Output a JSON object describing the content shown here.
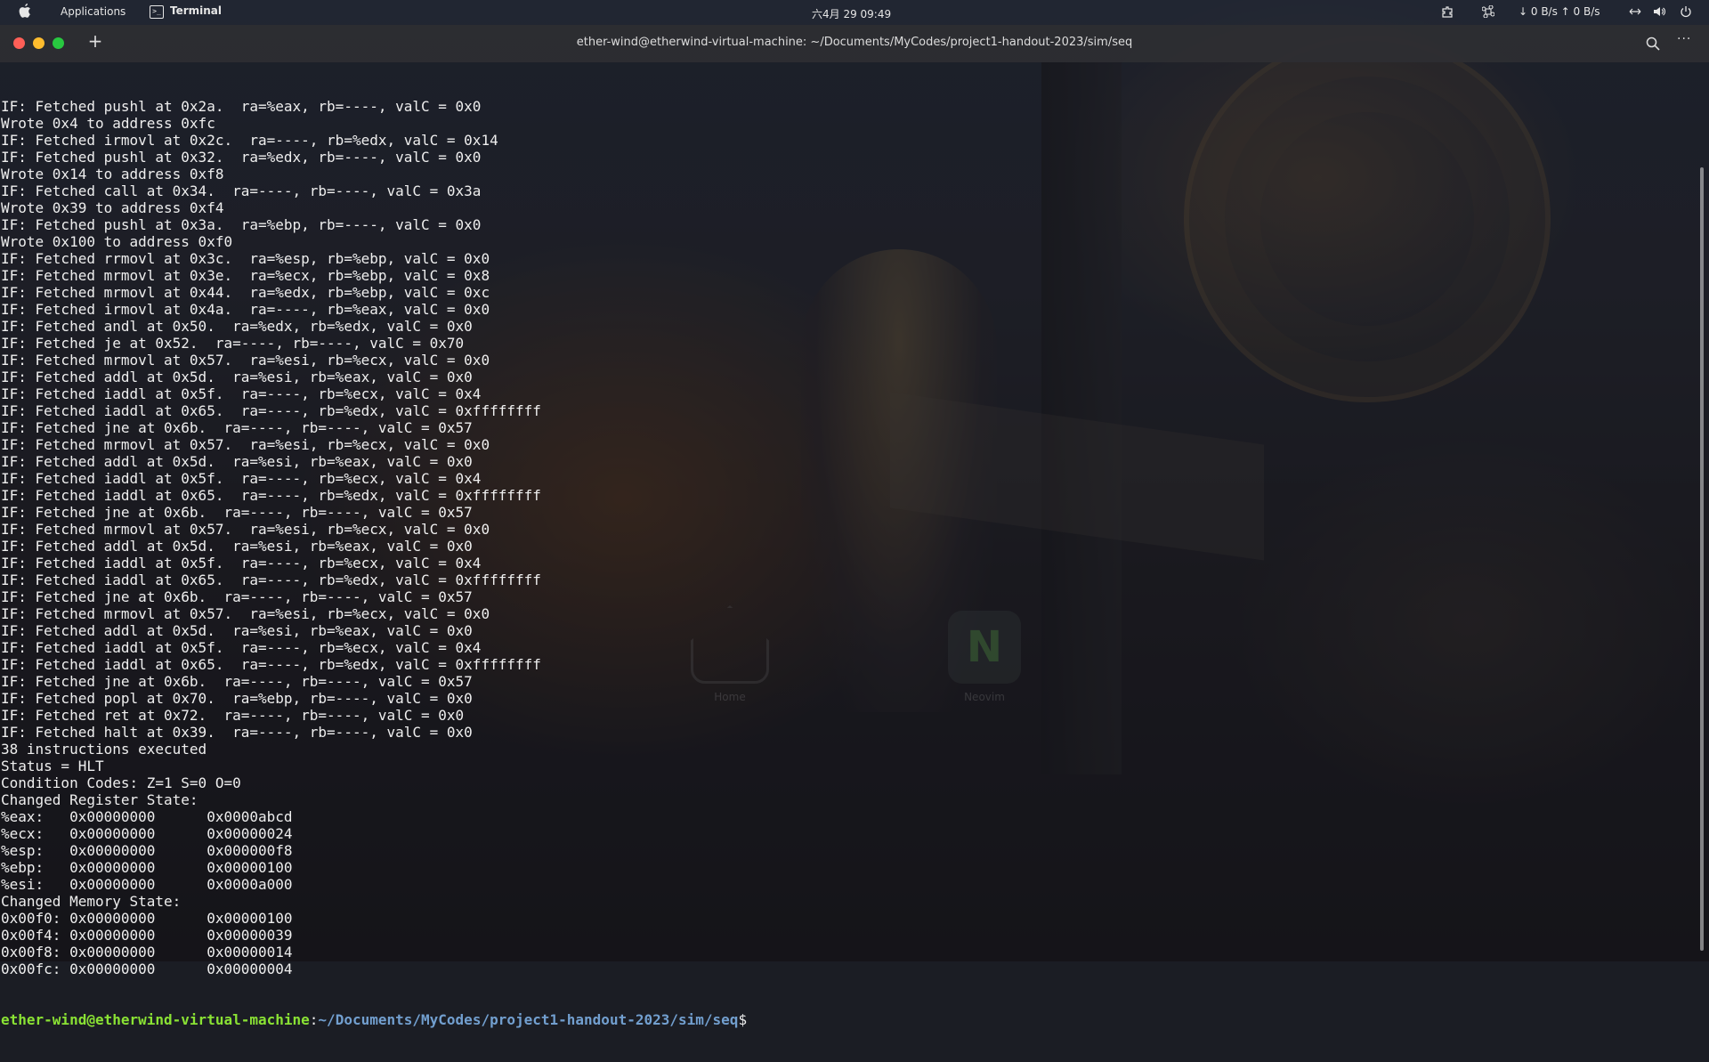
{
  "topbar": {
    "apps_label": "Applications",
    "terminal_icon_glyph": ">_",
    "active_app": "Terminal",
    "clock": "六4月 29  09:49",
    "net_speed": "↓ 0 B/s ↑ 0 B/s"
  },
  "window": {
    "title": "ether-wind@etherwind-virtual-machine: ~/Documents/MyCodes/project1-handout-2023/sim/seq",
    "new_tab_label": "+",
    "more_label": "···"
  },
  "desktop": {
    "icons": [
      {
        "label": "Home"
      },
      {
        "label": "Neovim",
        "glyph": "N"
      }
    ]
  },
  "terminal": {
    "lines": [
      "IF: Fetched pushl at 0x2a.  ra=%eax, rb=----, valC = 0x0",
      "Wrote 0x4 to address 0xfc",
      "IF: Fetched irmovl at 0x2c.  ra=----, rb=%edx, valC = 0x14",
      "IF: Fetched pushl at 0x32.  ra=%edx, rb=----, valC = 0x0",
      "Wrote 0x14 to address 0xf8",
      "IF: Fetched call at 0x34.  ra=----, rb=----, valC = 0x3a",
      "Wrote 0x39 to address 0xf4",
      "IF: Fetched pushl at 0x3a.  ra=%ebp, rb=----, valC = 0x0",
      "Wrote 0x100 to address 0xf0",
      "IF: Fetched rrmovl at 0x3c.  ra=%esp, rb=%ebp, valC = 0x0",
      "IF: Fetched mrmovl at 0x3e.  ra=%ecx, rb=%ebp, valC = 0x8",
      "IF: Fetched mrmovl at 0x44.  ra=%edx, rb=%ebp, valC = 0xc",
      "IF: Fetched irmovl at 0x4a.  ra=----, rb=%eax, valC = 0x0",
      "IF: Fetched andl at 0x50.  ra=%edx, rb=%edx, valC = 0x0",
      "IF: Fetched je at 0x52.  ra=----, rb=----, valC = 0x70",
      "IF: Fetched mrmovl at 0x57.  ra=%esi, rb=%ecx, valC = 0x0",
      "IF: Fetched addl at 0x5d.  ra=%esi, rb=%eax, valC = 0x0",
      "IF: Fetched iaddl at 0x5f.  ra=----, rb=%ecx, valC = 0x4",
      "IF: Fetched iaddl at 0x65.  ra=----, rb=%edx, valC = 0xffffffff",
      "IF: Fetched jne at 0x6b.  ra=----, rb=----, valC = 0x57",
      "IF: Fetched mrmovl at 0x57.  ra=%esi, rb=%ecx, valC = 0x0",
      "IF: Fetched addl at 0x5d.  ra=%esi, rb=%eax, valC = 0x0",
      "IF: Fetched iaddl at 0x5f.  ra=----, rb=%ecx, valC = 0x4",
      "IF: Fetched iaddl at 0x65.  ra=----, rb=%edx, valC = 0xffffffff",
      "IF: Fetched jne at 0x6b.  ra=----, rb=----, valC = 0x57",
      "IF: Fetched mrmovl at 0x57.  ra=%esi, rb=%ecx, valC = 0x0",
      "IF: Fetched addl at 0x5d.  ra=%esi, rb=%eax, valC = 0x0",
      "IF: Fetched iaddl at 0x5f.  ra=----, rb=%ecx, valC = 0x4",
      "IF: Fetched iaddl at 0x65.  ra=----, rb=%edx, valC = 0xffffffff",
      "IF: Fetched jne at 0x6b.  ra=----, rb=----, valC = 0x57",
      "IF: Fetched mrmovl at 0x57.  ra=%esi, rb=%ecx, valC = 0x0",
      "IF: Fetched addl at 0x5d.  ra=%esi, rb=%eax, valC = 0x0",
      "IF: Fetched iaddl at 0x5f.  ra=----, rb=%ecx, valC = 0x4",
      "IF: Fetched iaddl at 0x65.  ra=----, rb=%edx, valC = 0xffffffff",
      "IF: Fetched jne at 0x6b.  ra=----, rb=----, valC = 0x57",
      "IF: Fetched popl at 0x70.  ra=%ebp, rb=----, valC = 0x0",
      "IF: Fetched ret at 0x72.  ra=----, rb=----, valC = 0x0",
      "IF: Fetched halt at 0x39.  ra=----, rb=----, valC = 0x0",
      "38 instructions executed",
      "Status = HLT",
      "Condition Codes: Z=1 S=0 O=0",
      "Changed Register State:",
      "%eax:   0x00000000      0x0000abcd",
      "%ecx:   0x00000000      0x00000024",
      "%esp:   0x00000000      0x000000f8",
      "%ebp:   0x00000000      0x00000100",
      "%esi:   0x00000000      0x0000a000",
      "Changed Memory State:",
      "0x00f0: 0x00000000      0x00000100",
      "0x00f4: 0x00000000      0x00000039",
      "0x00f8: 0x00000000      0x00000014",
      "0x00fc: 0x00000000      0x00000004"
    ],
    "prompt": {
      "user_host": "ether-wind@etherwind-virtual-machine",
      "separator": ":",
      "path": "~/Documents/MyCodes/project1-handout-2023/sim/seq",
      "symbol": "$"
    }
  },
  "colors": {
    "prompt_user": "#8ae234",
    "prompt_path": "#729fcf",
    "close": "#ff5f57",
    "minimize": "#febc2e",
    "maximize": "#28c840"
  }
}
